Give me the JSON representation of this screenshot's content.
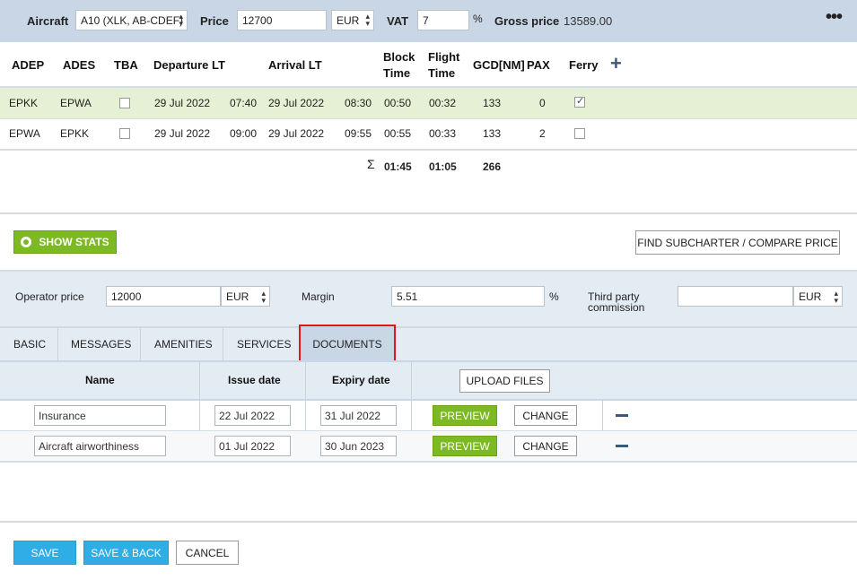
{
  "topbar": {
    "aircraft_label": "Aircraft",
    "aircraft_value": "A10 (XLK, AB-CDEF)",
    "price_label": "Price",
    "price_value": "12700",
    "currency_value": "EUR",
    "vat_label": "VAT",
    "vat_value": "7",
    "vat_unit": "%",
    "gross_label": "Gross price",
    "gross_value": "13589.00",
    "more_icon": "more-dots-icon"
  },
  "legs": {
    "headers": {
      "adep": "ADEP",
      "ades": "ADES",
      "tba": "TBA",
      "departure": "Departure LT",
      "arrival": "Arrival LT",
      "block_1": "Block",
      "block_2": "Time",
      "flight_1": "Flight",
      "flight_2": "Time",
      "gcd": "GCD[NM]",
      "pax": "PAX",
      "ferry": "Ferry",
      "add_icon": "plus-icon"
    },
    "rows": [
      {
        "adep": "EPKK",
        "ades": "EPWA",
        "tba": false,
        "dep_date": "29 Jul 2022",
        "dep_time": "07:40",
        "arr_date": "29 Jul 2022",
        "arr_time": "08:30",
        "block": "00:50",
        "flight": "00:32",
        "gcd": "133",
        "pax": "0",
        "ferry": true
      },
      {
        "adep": "EPWA",
        "ades": "EPKK",
        "tba": false,
        "dep_date": "29 Jul 2022",
        "dep_time": "09:00",
        "arr_date": "29 Jul 2022",
        "arr_time": "09:55",
        "block": "00:55",
        "flight": "00:33",
        "gcd": "133",
        "pax": "2",
        "ferry": false
      }
    ],
    "totals": {
      "sigma": "Σ",
      "block": "01:45",
      "flight": "01:05",
      "gcd": "266"
    }
  },
  "actions": {
    "show_stats": "SHOW STATS",
    "find_subcharter": "FIND SUBCHARTER / COMPARE PRICE"
  },
  "operator": {
    "price_label": "Operator price",
    "price_value": "12000",
    "price_currency": "EUR",
    "margin_label": "Margin",
    "margin_value": "5.51",
    "margin_unit": "%",
    "third_party_label_1": "Third party",
    "third_party_label_2": "commission",
    "third_party_value": "",
    "third_party_currency": "EUR"
  },
  "tabs": [
    {
      "label": "BASIC",
      "active": false
    },
    {
      "label": "MESSAGES",
      "active": false
    },
    {
      "label": "AMENITIES",
      "active": false
    },
    {
      "label": "SERVICES",
      "active": false
    },
    {
      "label": "DOCUMENTS",
      "active": true
    }
  ],
  "documents": {
    "headers": {
      "name": "Name",
      "issue": "Issue date",
      "expiry": "Expiry date"
    },
    "upload_label": "UPLOAD FILES",
    "rows": [
      {
        "name": "Insurance",
        "issue": "22 Jul 2022",
        "expiry": "31 Jul 2022",
        "preview": "PREVIEW",
        "change": "CHANGE"
      },
      {
        "name": "Aircraft airworthiness",
        "issue": "01 Jul 2022",
        "expiry": "30 Jun 2023",
        "preview": "PREVIEW",
        "change": "CHANGE"
      }
    ]
  },
  "footer": {
    "save": "SAVE",
    "save_back": "SAVE & BACK",
    "cancel": "CANCEL"
  },
  "colors": {
    "topbar": "#c9d6e6",
    "green": "#7cb922",
    "blue": "#2faee6",
    "highlight_row": "#e6f0d4",
    "active_tab_outline": "#e0161a"
  }
}
